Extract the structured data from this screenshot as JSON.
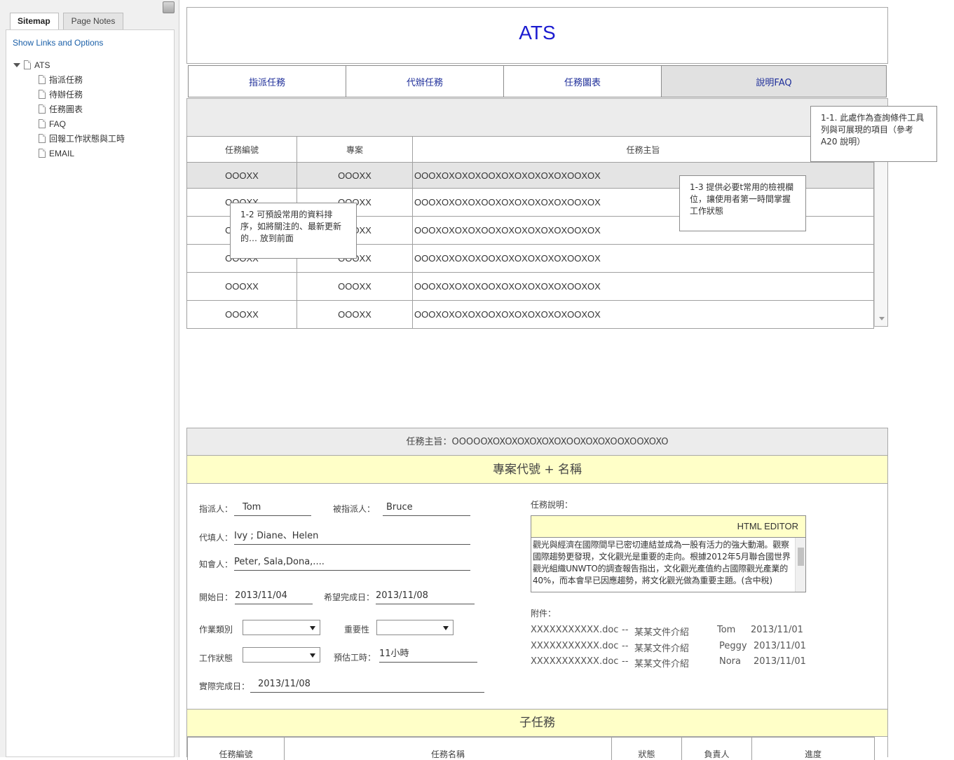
{
  "sidebar": {
    "tabs": [
      "Sitemap",
      "Page Notes"
    ],
    "show_links": "Show Links and Options",
    "tree": {
      "root": "ATS",
      "children": [
        "指派任務",
        "待辦任務",
        "任務圖表",
        "FAQ",
        "回報工作狀態與工時",
        "EMAIL"
      ]
    }
  },
  "app": {
    "title": "ATS"
  },
  "nav": {
    "tabs": [
      "指派任務",
      "代辦任務",
      "任務圖表",
      "說明FAQ"
    ]
  },
  "task_table": {
    "headers": [
      "任務編號",
      "專案",
      "任務主旨"
    ],
    "rows": [
      [
        "OOOXX",
        "OOOXX",
        "OOOXOXOXOXOOXOXOXOXOXOXOOXOX"
      ],
      [
        "OOOXX",
        "OOOXX",
        "OOOXOXOXOXOOXOXOXOXOXOXOOXOX"
      ],
      [
        "OOOXX",
        "OOOXX",
        "OOOXOXOXOXOOXOXOXOXOXOXOOXOX"
      ],
      [
        "OOOXX",
        "OOOXX",
        "OOOXOXOXOXOOXOXOXOXOXOXOOXOX"
      ],
      [
        "OOOXX",
        "OOOXX",
        "OOOXOXOXOXOOXOXOXOXOXOXOOXOX"
      ],
      [
        "OOOXX",
        "OOOXX",
        "OOOXOXOXOXOOXOXOXOXOXOXOOXOX"
      ]
    ]
  },
  "notes": {
    "note_1": "1-1. 此處作為查詢條件工具列與可展現的項目（參考A20 說明）",
    "note_2": "1-2  可預設常用的資料排序，如將關注的、最新更新的… 放到前面",
    "note_3": "1-3  提供必要t常用的檢視欄位，讓使用者第一時間掌握工作狀態"
  },
  "detail": {
    "subject_line": "任務主旨：OOOOOXOXOXOXOXOXOXOOXOXOXOOXOOXOXO",
    "project_title": "專案代號 + 名稱",
    "assigner_label": "指派人：",
    "assigner": "Tom",
    "assignee_label": "被指派人：",
    "assignee": "Bruce",
    "proxy_label": "代填人：",
    "proxy": "Ivy ; Diane、Helen",
    "cc_label": "知會人：",
    "cc": "Peter, Sala,Dona,....",
    "start_label": "開始日：",
    "start_date": "2013/11/04",
    "due_label": "希望完成日：",
    "due_date": "2013/11/08",
    "work_type_label": "作業類別",
    "importance_label": "重要性",
    "status_label": "工作狀態",
    "est_hours_label": "預估工時：",
    "est_hours": "11小時",
    "actual_done_label": "實際完成日：",
    "actual_done": "2013/11/08",
    "description_label": "任務說明：",
    "editor_label": "HTML   EDITOR",
    "description": "觀光與經濟在國際間早已密切連結並成為一股有活力的強大動潮。觀察國際趨勢更發現，文化觀光是重要的走向。根據2012年5月聯合國世界觀光組織UNWTO的調查報告指出，文化觀光產值約占國際觀光產業的40%，而本會早已因應趨勢，將文化觀光做為重要主題。(含中稅)",
    "attachments_label": "附件：",
    "attachments": [
      {
        "file": "XXXXXXXXXXX.doc",
        "sep": "--",
        "desc": "某某文件介紹",
        "user": "Tom",
        "date": "2013/11/01"
      },
      {
        "file": "XXXXXXXXXXX.doc",
        "sep": "--",
        "desc": "某某文件介紹",
        "user": "Peggy",
        "date": "2013/11/01"
      },
      {
        "file": "XXXXXXXXXXX.doc",
        "sep": "--",
        "desc": "某某文件介紹",
        "user": "Nora",
        "date": "2013/11/01"
      }
    ],
    "subtask_title": "子任務",
    "subtask_headers": [
      "任務編號",
      "任務名稱",
      "狀態",
      "負責人",
      "進度"
    ]
  }
}
